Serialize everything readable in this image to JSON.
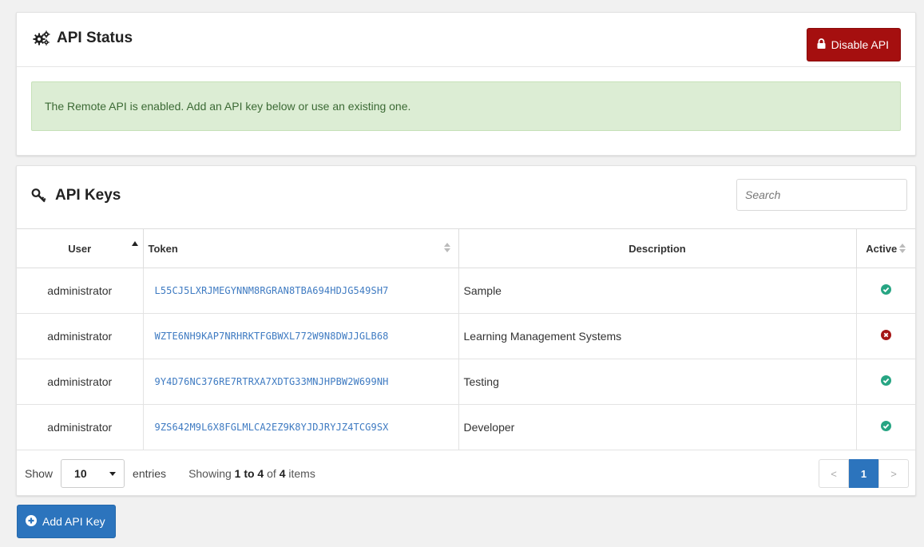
{
  "status_panel": {
    "title": "API Status",
    "title_icon": "gears-icon",
    "disable_button": "Disable API",
    "disable_icon": "lock-icon",
    "alert": "The Remote API is enabled. Add an API key below or use an existing one."
  },
  "keys_panel": {
    "title": "API Keys",
    "title_icon": "key-icon",
    "search_placeholder": "Search",
    "columns": {
      "user": "User",
      "token": "Token",
      "description": "Description",
      "active": "Active"
    },
    "rows": [
      {
        "user": "administrator",
        "token": "L55CJ5LXRJMEGYNNM8RGRAN8TBA694HDJG549SH7",
        "description": "Sample",
        "active": true
      },
      {
        "user": "administrator",
        "token": "WZTE6NH9KAP7NRHRKTFGBWXL772W9N8DWJJGLB68",
        "description": "Learning Management Systems",
        "active": false
      },
      {
        "user": "administrator",
        "token": "9Y4D76NC376RE7RTRXA7XDTG33MNJHPBW2W699NH",
        "description": "Testing",
        "active": true
      },
      {
        "user": "administrator",
        "token": "9ZS642M9L6X8FGLMLCA2EZ9K8YJDJRYJZ4TCG9SX",
        "description": "Developer",
        "active": true
      }
    ],
    "footer": {
      "show_label": "Show",
      "entries_value": "10",
      "entries_label": "entries",
      "showing_prefix": "Showing",
      "range": "1 to 4",
      "of_label": "of",
      "total": "4",
      "items_label": "items",
      "prev": "<",
      "current_page": "1",
      "next": ">"
    }
  },
  "add_button": "Add API Key",
  "add_icon": "plus-circle-icon",
  "colors": {
    "danger": "#a50f0f",
    "primary": "#2c74bd",
    "success_bg": "#dcedd4",
    "active_green": "#27a583",
    "inactive_red": "#a51616",
    "token_link": "#3f7bc2"
  }
}
